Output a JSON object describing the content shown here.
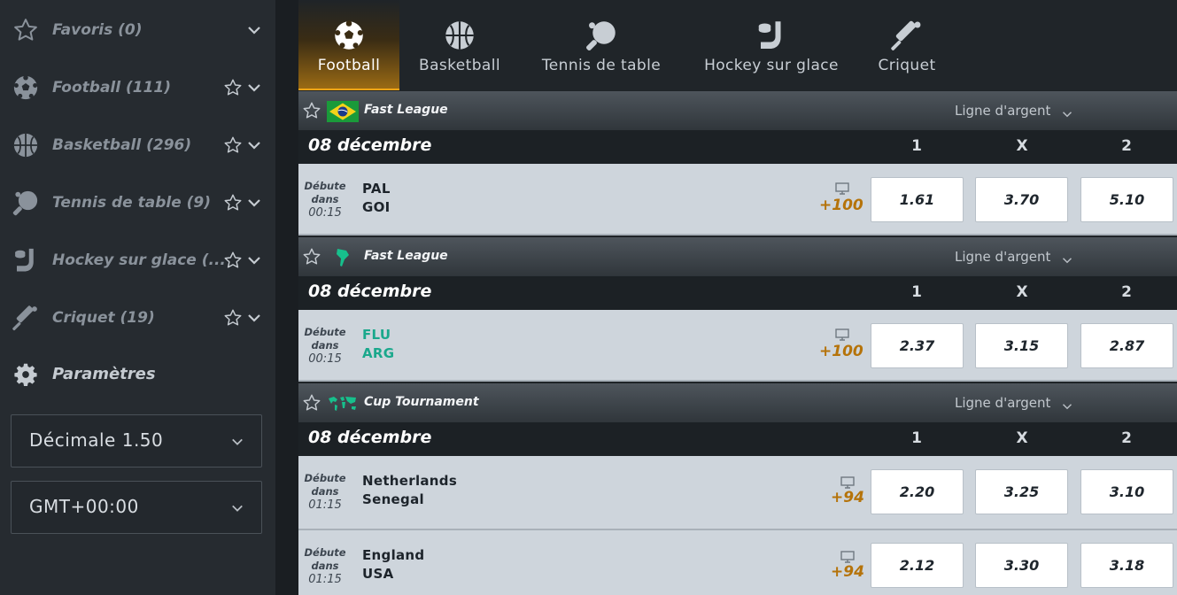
{
  "sidebar": {
    "items": [
      {
        "label": "Favoris (0)",
        "icon": "star-outline-icon",
        "has_star": false
      },
      {
        "label": "Football (111)",
        "icon": "soccer-ball-icon",
        "has_star": true
      },
      {
        "label": "Basketball (296)",
        "icon": "basketball-icon",
        "has_star": true
      },
      {
        "label": "Tennis de table (9)",
        "icon": "ping-pong-paddle-icon",
        "has_star": true
      },
      {
        "label": "Hockey sur glace (...",
        "icon": "hockey-stick-icon",
        "has_star": true
      },
      {
        "label": "Criquet (19)",
        "icon": "cricket-bat-icon",
        "has_star": true
      }
    ],
    "params_label": "Paramètres",
    "odds_format": "Décimale 1.50",
    "timezone": "GMT+00:00"
  },
  "tabs": [
    {
      "label": "Football",
      "icon": "soccer-ball-icon",
      "active": true
    },
    {
      "label": "Basketball",
      "icon": "basketball-icon",
      "active": false
    },
    {
      "label": "Tennis de table",
      "icon": "ping-pong-paddle-icon",
      "active": false
    },
    {
      "label": "Hockey sur glace",
      "icon": "hockey-stick-icon",
      "active": false
    },
    {
      "label": "Criquet",
      "icon": "cricket-bat-icon",
      "active": false
    }
  ],
  "columns": [
    "1",
    "X",
    "2"
  ],
  "leagues": [
    {
      "name": "Fast League",
      "flag": "brazil-flag-icon",
      "line_label": "Ligne d'argent",
      "date": "08 décembre",
      "matches": [
        {
          "starts_label_1": "Débute",
          "starts_label_2": "dans",
          "time": "00:15",
          "home": "PAL",
          "away": "GOI",
          "live": false,
          "more": "+100",
          "odds": [
            "1.61",
            "3.70",
            "5.10"
          ]
        }
      ]
    },
    {
      "name": "Fast League",
      "flag": "south-america-map-icon",
      "line_label": "Ligne d'argent",
      "date": "08 décembre",
      "matches": [
        {
          "starts_label_1": "Débute",
          "starts_label_2": "dans",
          "time": "00:15",
          "home": "FLU",
          "away": "ARG",
          "live": true,
          "more": "+100",
          "odds": [
            "2.37",
            "3.15",
            "2.87"
          ]
        }
      ]
    },
    {
      "name": "Cup Tournament",
      "flag": "world-map-icon",
      "line_label": "Ligne d'argent",
      "date": "08 décembre",
      "matches": [
        {
          "starts_label_1": "Débute",
          "starts_label_2": "dans",
          "time": "01:15",
          "home": "Netherlands",
          "away": "Senegal",
          "live": false,
          "more": "+94",
          "odds": [
            "2.20",
            "3.25",
            "3.10"
          ]
        },
        {
          "starts_label_1": "Débute",
          "starts_label_2": "dans",
          "time": "01:15",
          "home": "England",
          "away": "USA",
          "live": false,
          "more": "+94",
          "odds": [
            "2.12",
            "3.30",
            "3.18"
          ]
        }
      ]
    }
  ],
  "colors": {
    "accent": "#f0a417",
    "live_team": "#1aa88c",
    "more_markets": "#b5730a"
  }
}
